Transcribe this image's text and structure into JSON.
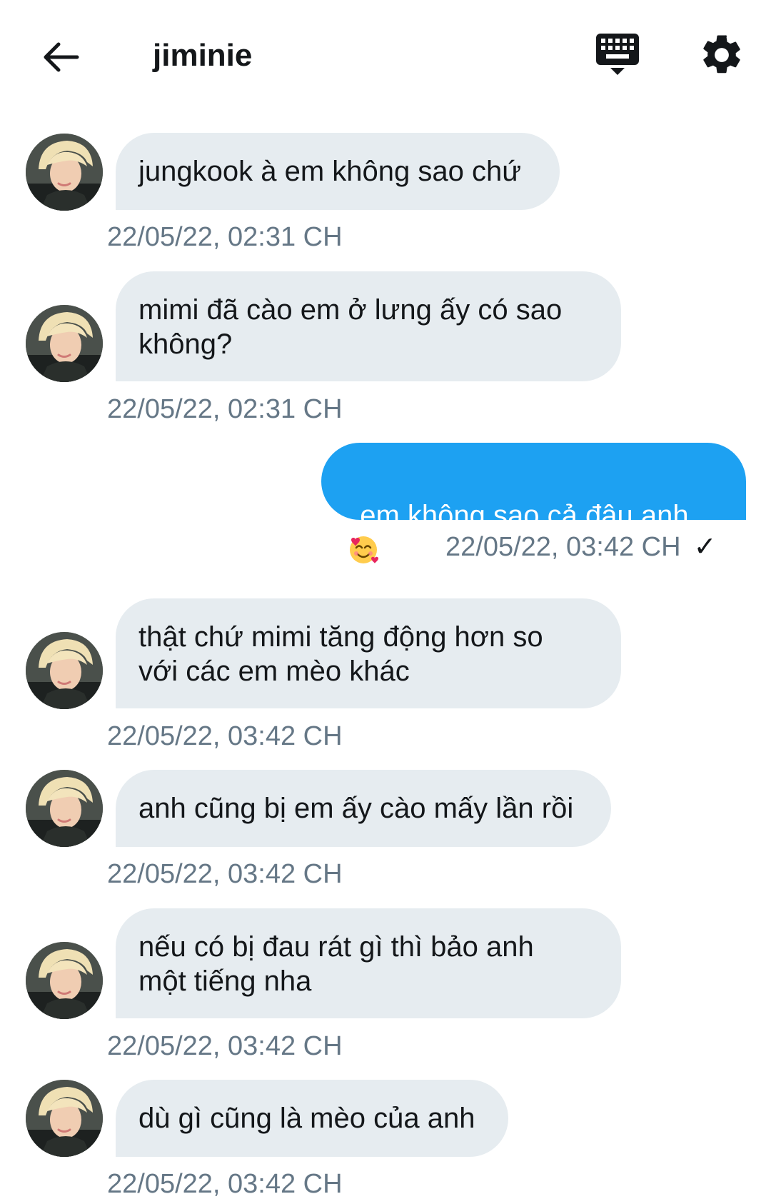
{
  "header": {
    "title": "jiminie",
    "back_icon": "arrow-left-icon",
    "keyboard_icon": "keyboard-icon",
    "settings_icon": "gear-icon"
  },
  "colors": {
    "incoming_bubble": "#e6ecf0",
    "outgoing_bubble": "#1da1f2",
    "timestamp": "#657786"
  },
  "messages": [
    {
      "direction": "incoming",
      "text": "jungkook à em không sao chứ",
      "time": "22/05/22, 02:31 CH"
    },
    {
      "direction": "incoming",
      "text": "mimi đã cào em ở lưng ấy có sao\nkhông?",
      "time": "22/05/22, 02:31 CH"
    },
    {
      "direction": "outgoing",
      "text": "em không sao cả đâu anh",
      "emoji": "smiling-face-with-hearts-emoji",
      "time": "22/05/22, 03:42 CH",
      "status": "✓"
    },
    {
      "direction": "incoming",
      "text": "thật chứ mimi tăng động hơn so\nvới các em mèo khác",
      "time": "22/05/22, 03:42 CH"
    },
    {
      "direction": "incoming",
      "text": "anh cũng bị em ấy cào mấy lần rồi",
      "time": "22/05/22, 03:42 CH"
    },
    {
      "direction": "incoming",
      "text": "nếu có bị đau rát gì thì bảo anh\nmột tiếng nha",
      "time": "22/05/22, 03:42 CH"
    },
    {
      "direction": "incoming",
      "text": "dù gì cũng là mèo của anh",
      "time": "22/05/22, 03:42 CH"
    }
  ]
}
